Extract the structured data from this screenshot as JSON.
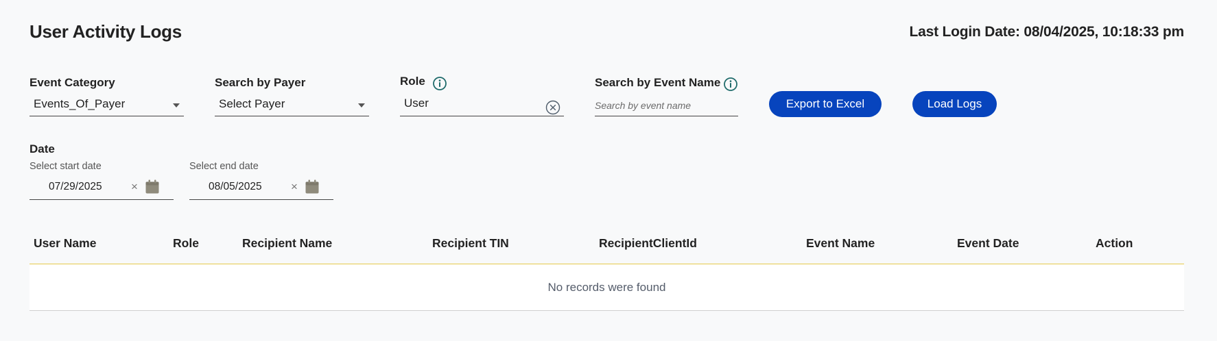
{
  "header": {
    "title": "User Activity Logs",
    "last_login": "Last Login Date: 08/04/2025, 10:18:33 pm"
  },
  "filters": {
    "event_category": {
      "label": "Event Category",
      "value": "Events_Of_Payer"
    },
    "payer": {
      "label": "Search by Payer",
      "value": "Select Payer"
    },
    "role": {
      "label": "Role",
      "value": "User"
    },
    "event_name": {
      "label": "Search by Event Name",
      "placeholder": "Search by event name",
      "value": ""
    }
  },
  "buttons": {
    "export": "Export to Excel",
    "load": "Load Logs"
  },
  "date": {
    "label": "Date",
    "start_label": "Select start date",
    "start_value": "07/29/2025",
    "end_label": "Select end date",
    "end_value": "08/05/2025",
    "clear_glyph": "×"
  },
  "table": {
    "columns": [
      "User Name",
      "Role",
      "Recipient Name",
      "Recipient TIN",
      "RecipientClientId",
      "Event Name",
      "Event Date",
      "Action"
    ],
    "empty_message": "No records were found"
  },
  "colors": {
    "primary_button": "#0744bd",
    "info_icon": "#1f6b6b",
    "header_underline": "#e6c94a",
    "calendar_icon": "#8f8b7c"
  },
  "icons": {
    "info": "info-circle-icon",
    "clear": "close-circle-icon",
    "calendar": "calendar-icon",
    "caret": "caret-down-icon"
  }
}
